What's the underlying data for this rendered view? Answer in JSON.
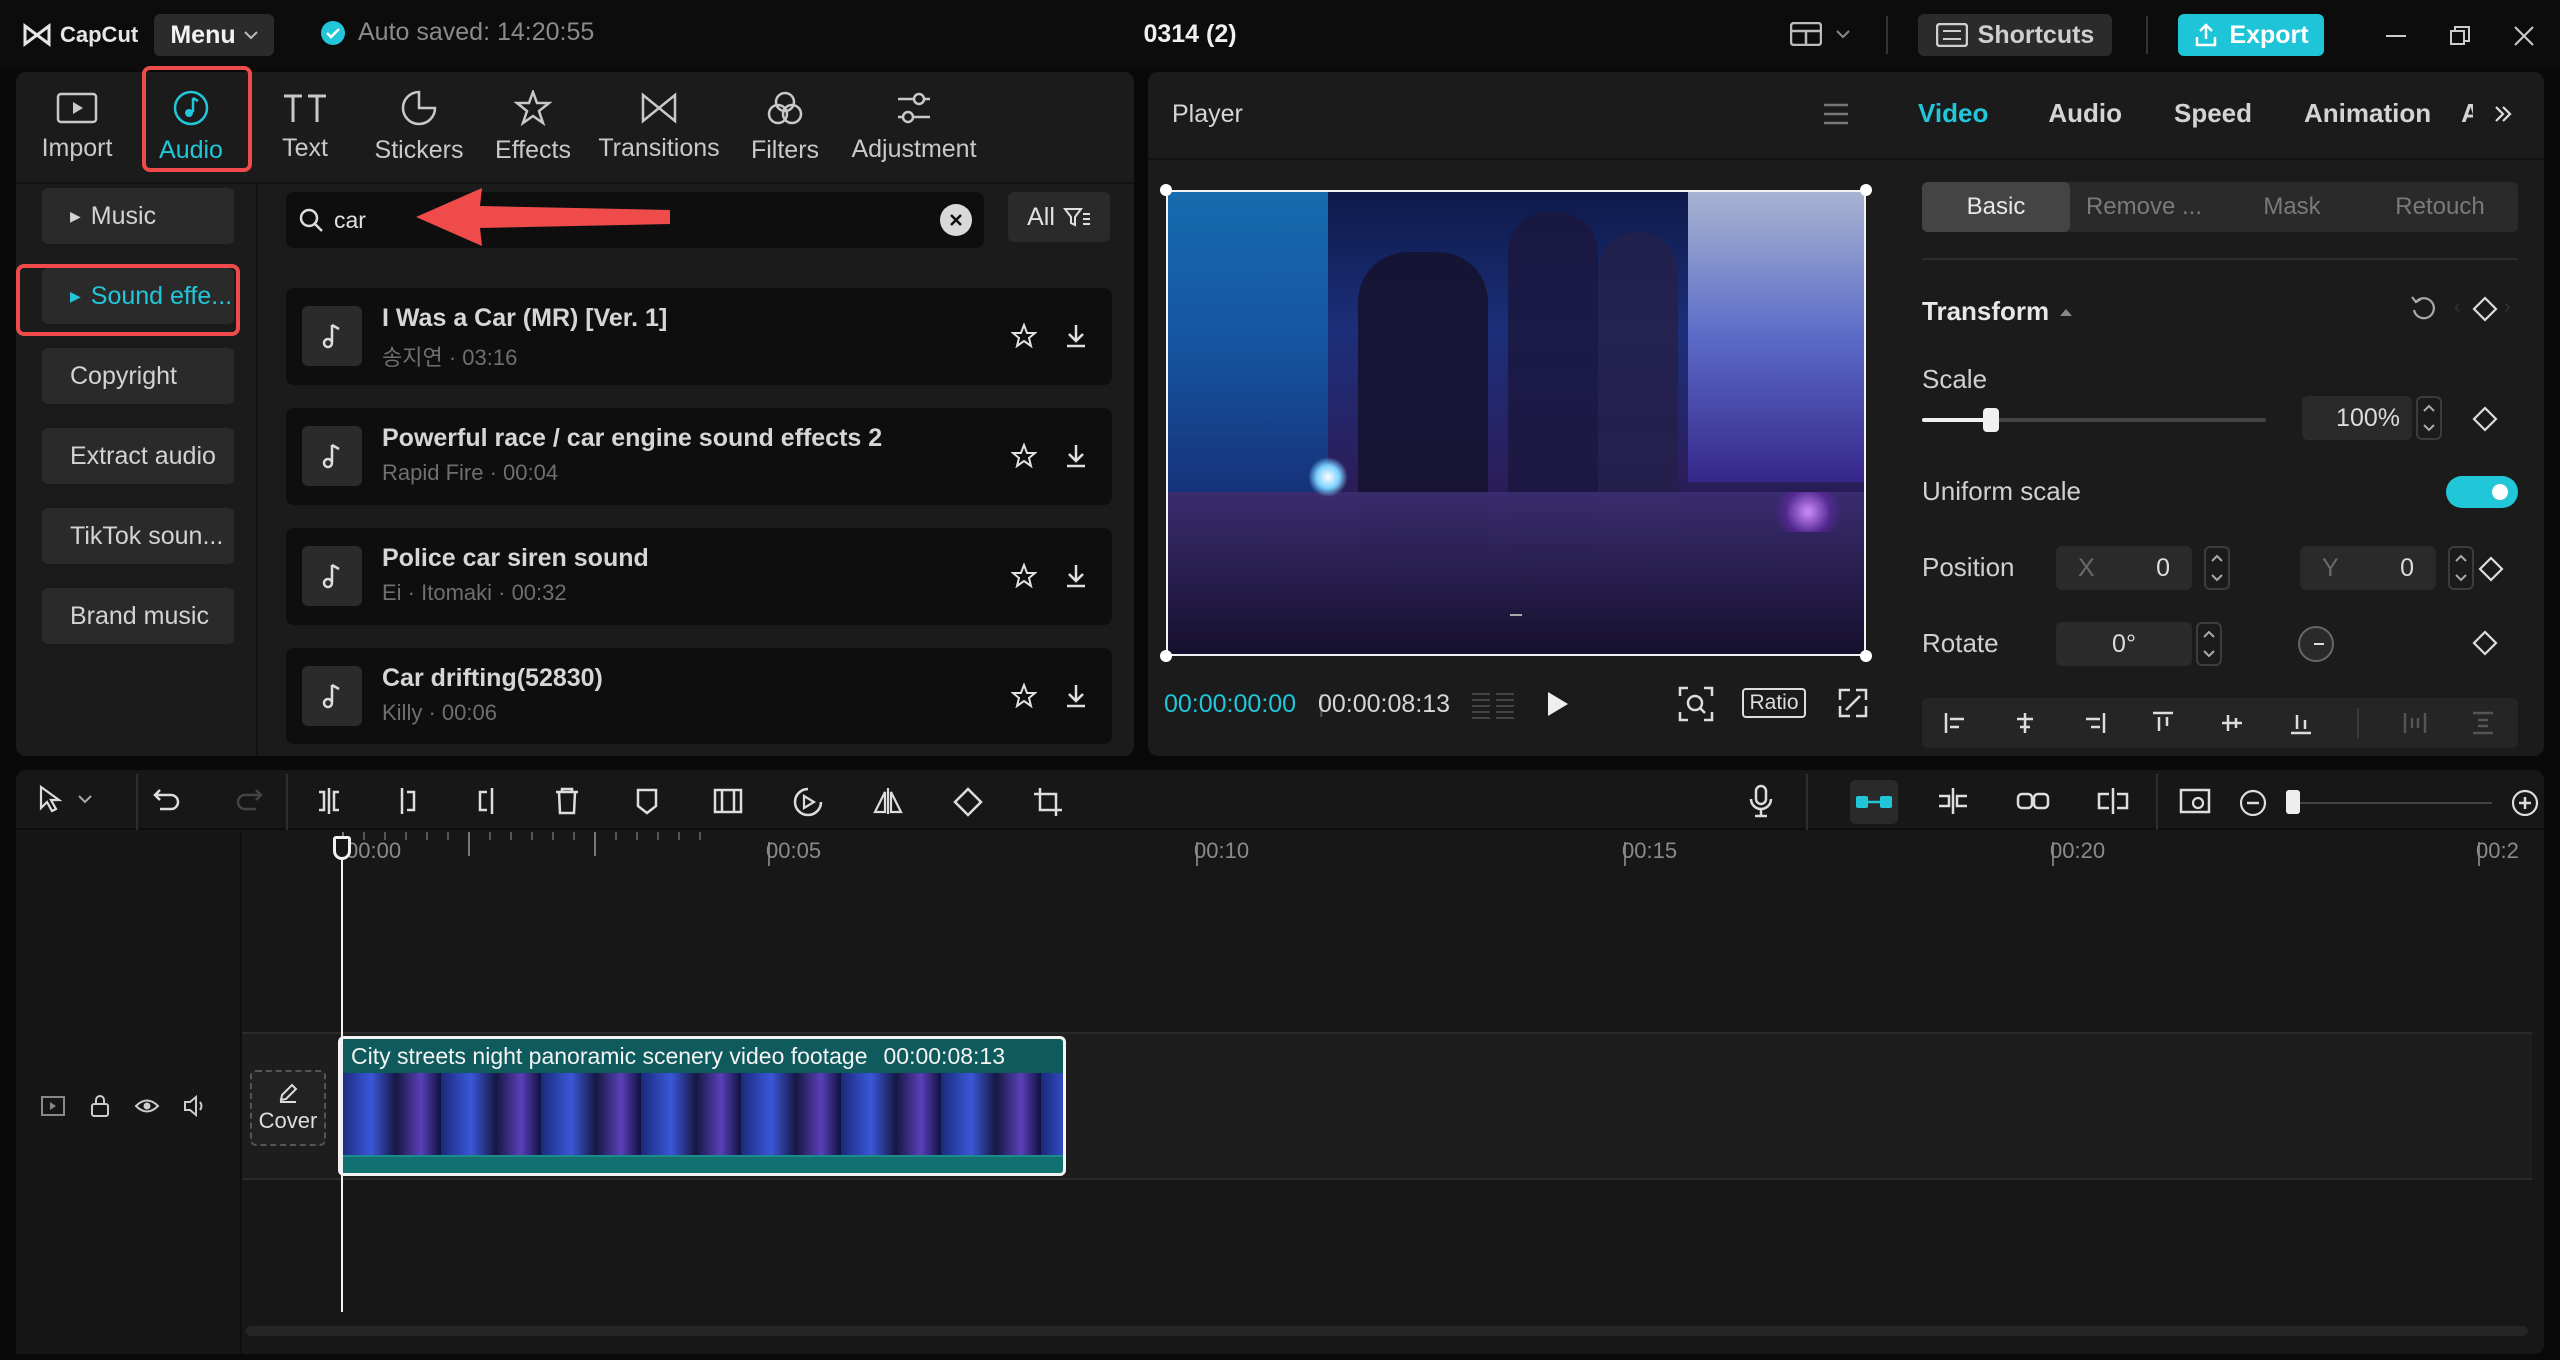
{
  "app": {
    "name": "CapCut",
    "menu_label": "Menu",
    "autosave": "Auto saved: 14:20:55",
    "title": "0314 (2)",
    "shortcuts_label": "Shortcuts",
    "export_label": "Export"
  },
  "tools": {
    "tabs": [
      "Import",
      "Audio",
      "Text",
      "Stickers",
      "Effects",
      "Transitions",
      "Filters",
      "Adjustment"
    ],
    "active": "Audio"
  },
  "audio_sidebar": {
    "items": [
      "Music",
      "Sound effe...",
      "Copyright",
      "Extract audio",
      "TikTok soun...",
      "Brand music"
    ],
    "active": "Sound effe..."
  },
  "search": {
    "value": "car",
    "filter_label": "All"
  },
  "results": [
    {
      "title": "I Was a Car (MR) [Ver. 1]",
      "meta": "송지연 · 03:16"
    },
    {
      "title": "Powerful race / car engine sound effects 2",
      "meta": "Rapid Fire · 00:04"
    },
    {
      "title": "Police car siren sound",
      "meta": "Ei · Itomaki · 00:32"
    },
    {
      "title": "Car drifting(52830)",
      "meta": "Killy · 00:06"
    }
  ],
  "player": {
    "title": "Player",
    "current_time": "00:00:00:00",
    "duration": "00:00:08:13",
    "ratio_label": "Ratio"
  },
  "inspector": {
    "tabs": [
      "Video",
      "Audio",
      "Speed",
      "Animation",
      "A"
    ],
    "active_tab": "Video",
    "subtabs": [
      "Basic",
      "Remove ...",
      "Mask",
      "Retouch"
    ],
    "active_subtab": "Basic",
    "section_title": "Transform",
    "scale_label": "Scale",
    "scale_value": "100%",
    "scale_fraction": 0.2,
    "uniform_label": "Uniform scale",
    "uniform_on": true,
    "position_label": "Position",
    "x_label": "X",
    "x_value": "0",
    "y_label": "Y",
    "y_value": "0",
    "rotate_label": "Rotate",
    "rotate_value": "0°"
  },
  "timeline": {
    "ruler_labels": [
      "00:00",
      "00:05",
      "00:10",
      "00:15",
      "00:20",
      "00:2"
    ],
    "cover_label": "Cover",
    "clip_title": "City streets night panoramic scenery video footage",
    "clip_duration": "00:00:08:13"
  },
  "colors": {
    "accent": "#22c6d9",
    "highlight": "#ef4b4b",
    "panel": "#1b1b1c",
    "background": "#090909"
  }
}
